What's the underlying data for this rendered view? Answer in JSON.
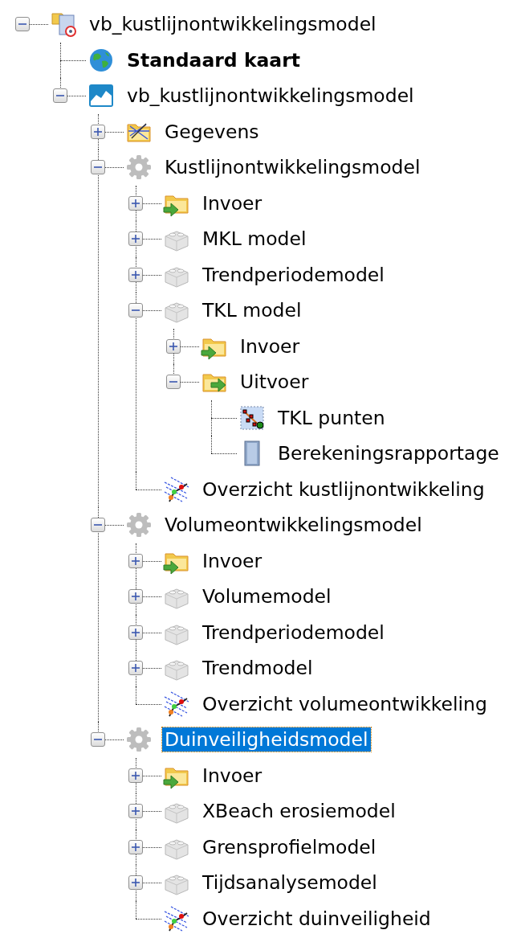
{
  "tree": [
    {
      "label": "vb_kustlijnontwikkelingsmodel",
      "kind": "project",
      "expanded": true,
      "selected": false,
      "children": [
        {
          "label": "Standaard kaart",
          "kind": "globe",
          "selected": false,
          "bold": true
        },
        {
          "label": "vb_kustlijnontwikkelingsmodel",
          "kind": "map",
          "expanded": true,
          "selected": false,
          "children": [
            {
              "label": "Gegevens",
              "kind": "data",
              "expanded": false,
              "selected": false
            },
            {
              "label": "Kustlijnontwikkelingsmodel",
              "kind": "model",
              "expanded": true,
              "selected": false,
              "children": [
                {
                  "label": "Invoer",
                  "kind": "input",
                  "expanded": false,
                  "selected": false
                },
                {
                  "label": "MKL model",
                  "kind": "submodel",
                  "expanded": false,
                  "selected": false
                },
                {
                  "label": "Trendperiodemodel",
                  "kind": "submodel",
                  "expanded": false,
                  "selected": false
                },
                {
                  "label": "TKL model",
                  "kind": "submodel",
                  "expanded": true,
                  "selected": false,
                  "children": [
                    {
                      "label": "Invoer",
                      "kind": "input",
                      "expanded": false,
                      "selected": false
                    },
                    {
                      "label": "Uitvoer",
                      "kind": "output",
                      "expanded": true,
                      "selected": false,
                      "children": [
                        {
                          "label": "TKL punten",
                          "kind": "points",
                          "selected": false
                        },
                        {
                          "label": "Berekeningsrapportage",
                          "kind": "report",
                          "selected": false
                        }
                      ]
                    }
                  ]
                },
                {
                  "label": "Overzicht kustlijnontwikkeling",
                  "kind": "overview",
                  "selected": false
                }
              ]
            },
            {
              "label": "Volumeontwikkelingsmodel",
              "kind": "model",
              "expanded": true,
              "selected": false,
              "children": [
                {
                  "label": "Invoer",
                  "kind": "input",
                  "expanded": false,
                  "selected": false
                },
                {
                  "label": "Volumemodel",
                  "kind": "submodel",
                  "expanded": false,
                  "selected": false
                },
                {
                  "label": "Trendperiodemodel",
                  "kind": "submodel",
                  "expanded": false,
                  "selected": false
                },
                {
                  "label": "Trendmodel",
                  "kind": "submodel",
                  "expanded": false,
                  "selected": false
                },
                {
                  "label": "Overzicht volumeontwikkeling",
                  "kind": "overview",
                  "selected": false
                }
              ]
            },
            {
              "label": "Duinveiligheidsmodel",
              "kind": "model",
              "expanded": true,
              "selected": true,
              "children": [
                {
                  "label": "Invoer",
                  "kind": "input",
                  "expanded": false,
                  "selected": false
                },
                {
                  "label": "XBeach erosiemodel",
                  "kind": "submodel",
                  "expanded": false,
                  "selected": false
                },
                {
                  "label": "Grensprofielmodel",
                  "kind": "submodel",
                  "expanded": false,
                  "selected": false
                },
                {
                  "label": "Tijdsanalysemodel",
                  "kind": "submodel",
                  "expanded": false,
                  "selected": false
                },
                {
                  "label": "Overzicht duinveiligheid",
                  "kind": "overview",
                  "selected": false
                }
              ]
            }
          ]
        }
      ]
    }
  ]
}
